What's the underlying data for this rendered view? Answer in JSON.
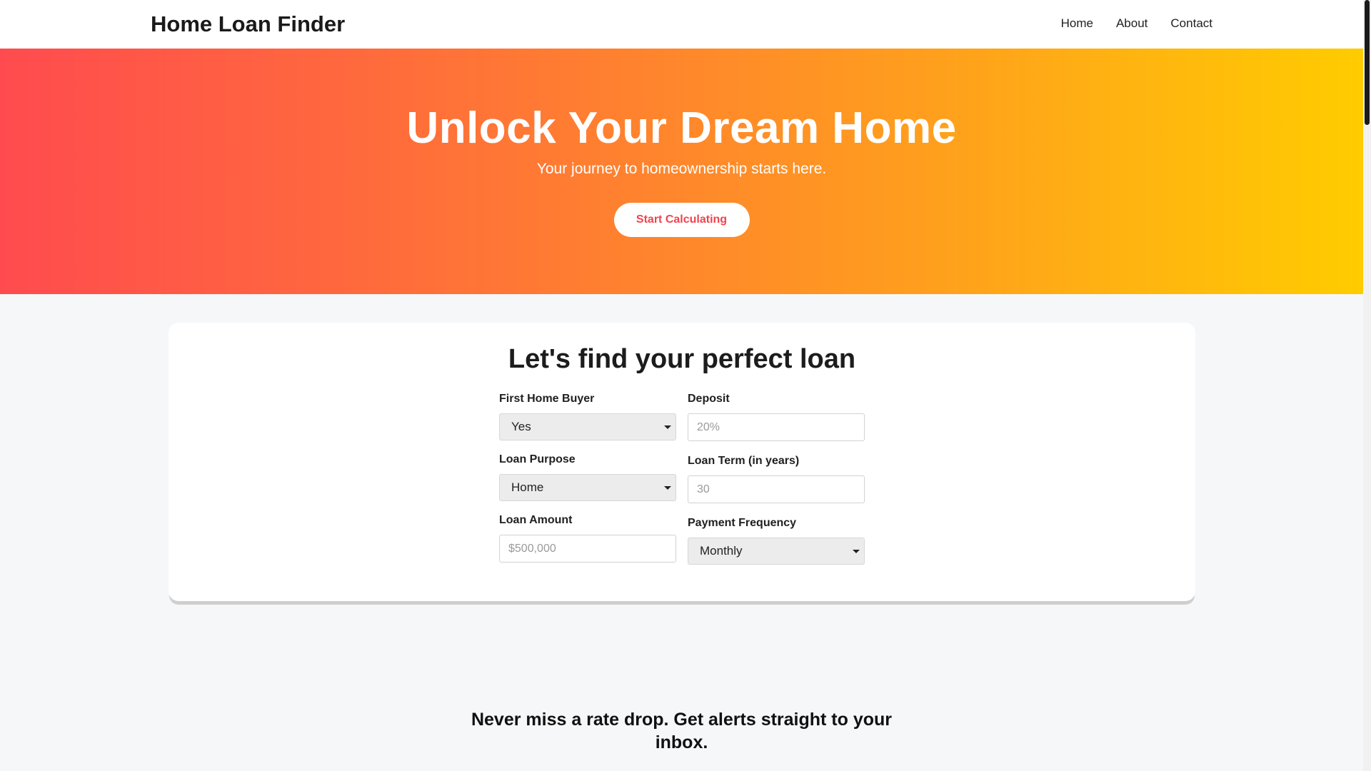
{
  "header": {
    "brand": "Home Loan Finder",
    "nav": [
      "Home",
      "About",
      "Contact"
    ]
  },
  "hero": {
    "title": "Unlock Your Dream Home",
    "subtitle": "Your journey to homeownership starts here.",
    "cta_label": "Start Calculating"
  },
  "form": {
    "title": "Let's find your perfect loan",
    "first_home_buyer": {
      "label": "First Home Buyer",
      "value": "Yes"
    },
    "deposit": {
      "label": "Deposit",
      "placeholder": "20%"
    },
    "loan_purpose": {
      "label": "Loan Purpose",
      "value": "Home"
    },
    "loan_term": {
      "label": "Loan Term (in years)",
      "placeholder": "30"
    },
    "loan_amount": {
      "label": "Loan Amount",
      "placeholder": "$500,000"
    },
    "payment_frequency": {
      "label": "Payment Frequency",
      "value": "Monthly"
    }
  },
  "newsletter": {
    "heading": "Never miss a rate drop. Get alerts straight to your inbox."
  },
  "colors": {
    "hero_gradient_start": "#ff4b4f",
    "hero_gradient_end": "#ffcc00",
    "cta_text": "#f1434d"
  }
}
